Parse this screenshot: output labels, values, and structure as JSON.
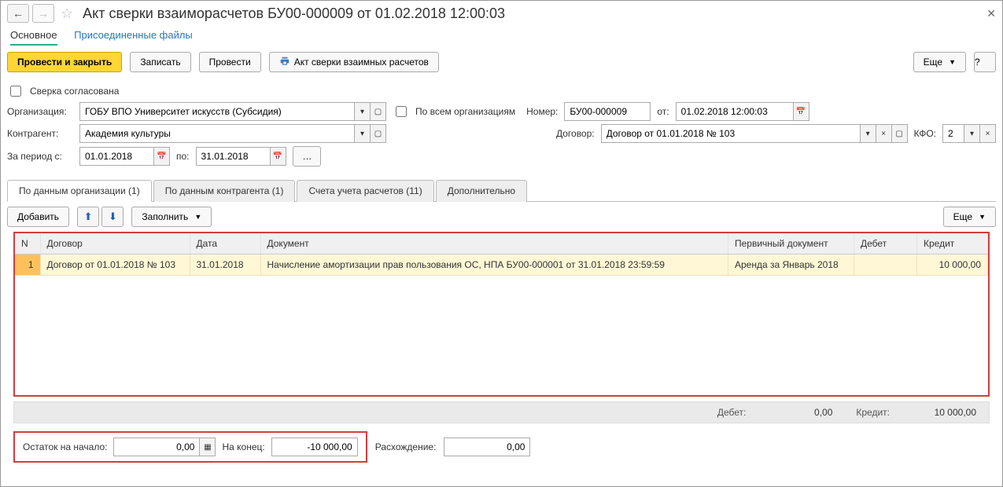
{
  "title": "Акт сверки взаиморасчетов БУ00-000009 от 01.02.2018 12:00:03",
  "subnav": {
    "main": "Основное",
    "attachments": "Присоединенные файлы"
  },
  "toolbar": {
    "post_close": "Провести и закрыть",
    "save": "Записать",
    "post": "Провести",
    "print": "Акт сверки взаимных расчетов",
    "more": "Еще"
  },
  "checkbox_agreed": "Сверка согласована",
  "labels": {
    "org": "Организация:",
    "all_orgs": "По всем организациям",
    "number": "Номер:",
    "from": "от:",
    "counterparty": "Контрагент:",
    "contract": "Договор:",
    "kfo": "КФО:",
    "period_from": "За период с:",
    "period_to": "по:"
  },
  "fields": {
    "org": "ГОБУ ВПО Университет искусств (Субсидия)",
    "number": "БУ00-000009",
    "date": "01.02.2018 12:00:03",
    "counterparty": "Академия культуры",
    "contract": "Договор от 01.01.2018 № 103",
    "kfo": "2",
    "period_from": "01.01.2018",
    "period_to": "31.01.2018"
  },
  "tabs": {
    "t1": "По данным организации (1)",
    "t2": "По данным контрагента (1)",
    "t3": "Счета учета расчетов (11)",
    "t4": "Дополнительно"
  },
  "subtoolbar": {
    "add": "Добавить",
    "fill": "Заполнить",
    "more": "Еще"
  },
  "grid": {
    "cols": {
      "n": "N",
      "contract": "Договор",
      "date": "Дата",
      "doc": "Документ",
      "primary": "Первичный документ",
      "debit": "Дебет",
      "credit": "Кредит"
    },
    "rows": [
      {
        "n": "1",
        "contract": "Договор от 01.01.2018 № 103",
        "date": "31.01.2018",
        "doc": "Начисление амортизации прав пользования ОС, НПА БУ00-000001 от 31.01.2018 23:59:59",
        "primary": "Аренда за Январь 2018",
        "debit": "",
        "credit": "10 000,00"
      }
    ]
  },
  "totals": {
    "debit_label": "Дебет:",
    "debit": "0,00",
    "credit_label": "Кредит:",
    "credit": "10 000,00"
  },
  "footer": {
    "start_label": "Остаток на начало:",
    "start": "0,00",
    "end_label": "На конец:",
    "end": "-10 000,00",
    "diff_label": "Расхождение:",
    "diff": "0,00"
  }
}
